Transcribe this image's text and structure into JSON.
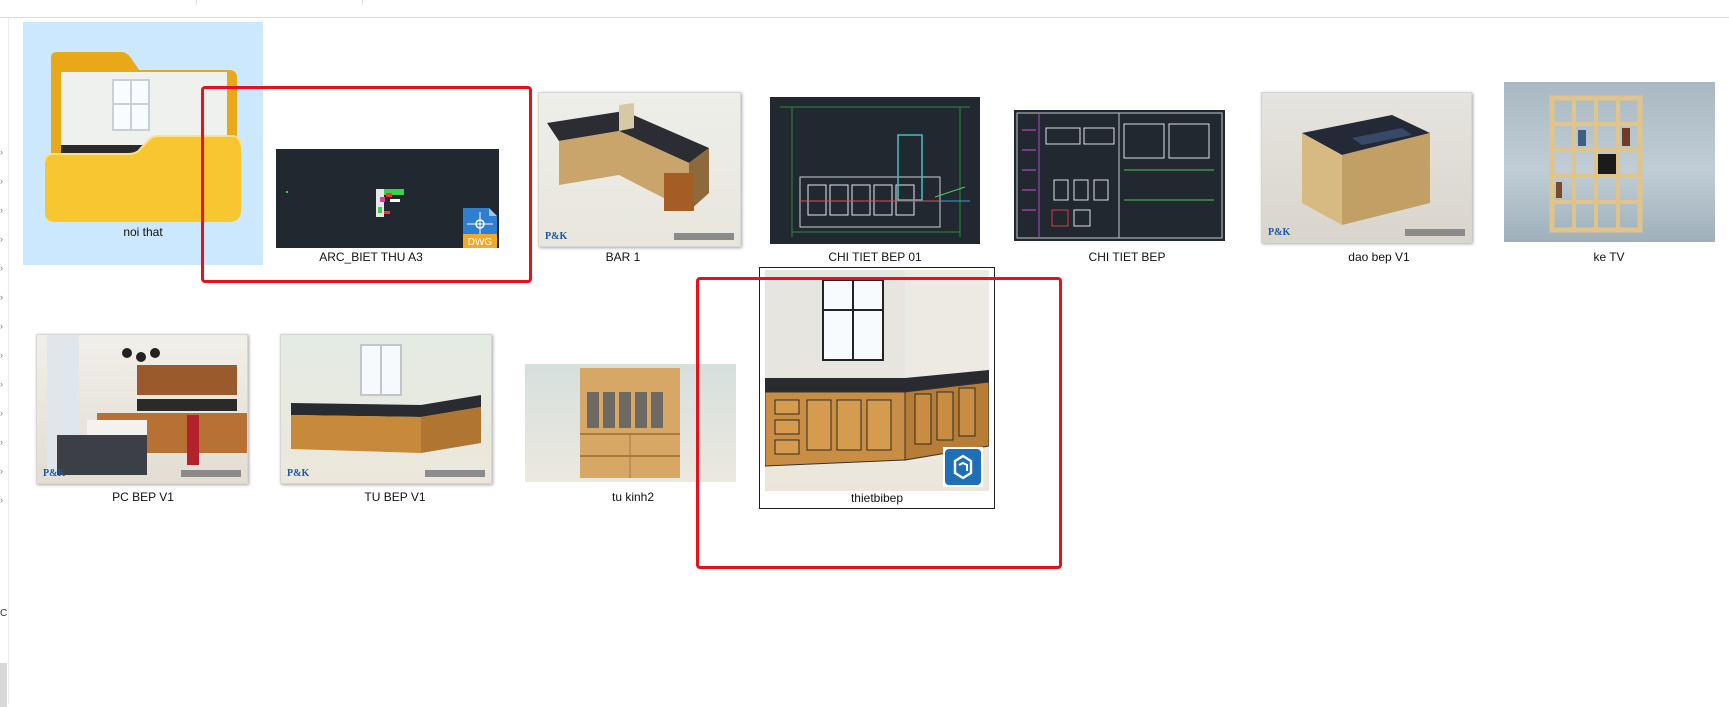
{
  "items": [
    {
      "label": "noi that",
      "type": "folder"
    },
    {
      "label": "ARC_BIET THU A3",
      "type": "dwg",
      "badge": "DWG"
    },
    {
      "label": "BAR 1",
      "type": "image",
      "logo": "P&K"
    },
    {
      "label": "CHI TIET BEP 01",
      "type": "drawing"
    },
    {
      "label": "CHI TIET BEP",
      "type": "drawing"
    },
    {
      "label": "dao bep V1",
      "type": "image",
      "logo": "P&K"
    },
    {
      "label": "ke TV",
      "type": "image"
    },
    {
      "label": "PC BEP V1",
      "type": "image",
      "logo": "P&K"
    },
    {
      "label": "TU BEP V1",
      "type": "image",
      "logo": "P&K"
    },
    {
      "label": "tu kinh2",
      "type": "image"
    },
    {
      "label": "thietbibep",
      "type": "sketchup",
      "badge_icon": "sketchup-icon"
    }
  ],
  "colors": {
    "selection": "#cce8ff",
    "highlight_box": "#e8101d",
    "cad_background": "#212830",
    "folder_yellow": "#f7c631"
  }
}
